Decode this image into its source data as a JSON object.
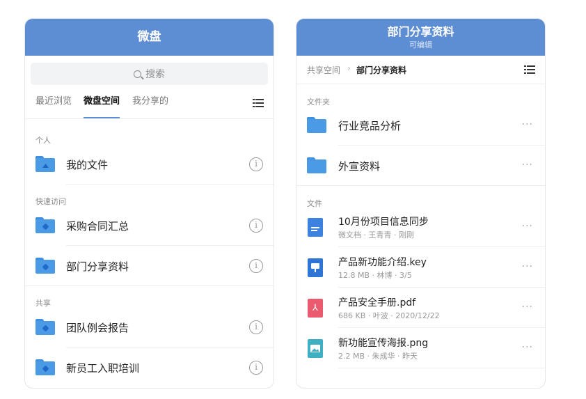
{
  "left_panel": {
    "title": "微盘",
    "search_placeholder": "搜索",
    "tabs": [
      {
        "label": "最近浏览",
        "active": false
      },
      {
        "label": "微盘空间",
        "active": true
      },
      {
        "label": "我分享的",
        "active": false
      }
    ],
    "sections": [
      {
        "label": "个人",
        "items": [
          {
            "name": "我的文件",
            "icon": "person-folder-icon"
          }
        ]
      },
      {
        "label": "快速访问",
        "items": [
          {
            "name": "采购合同汇总",
            "icon": "shared-folder-icon"
          },
          {
            "name": "部门分享资料",
            "icon": "shared-folder-icon"
          }
        ]
      },
      {
        "label": "共享",
        "items": [
          {
            "name": "团队例会报告",
            "icon": "shared-folder-icon"
          },
          {
            "name": "新员工入职培训",
            "icon": "shared-folder-icon"
          }
        ]
      }
    ],
    "info_glyph": "i"
  },
  "right_panel": {
    "title": "部门分享资料",
    "subtitle": "可编辑",
    "breadcrumb": {
      "root": "共享空间",
      "separator": "›",
      "current": "部门分享资料"
    },
    "folders_label": "文件夹",
    "folders": [
      {
        "name": "行业竞品分析"
      },
      {
        "name": "外宣资料"
      }
    ],
    "files_label": "文件",
    "files": [
      {
        "name": "10月份项目信息同步",
        "meta": "微文档 · 王青青 · 刚刚",
        "icon": "doc-icon"
      },
      {
        "name": "产品新功能介绍.key",
        "meta": "12.8 MB · 林博 · 3/5",
        "icon": "keynote-icon"
      },
      {
        "name": "产品安全手册.pdf",
        "meta": "686 KB · 叶波 · 2020/12/22",
        "icon": "pdf-icon"
      },
      {
        "name": "新功能宣传海报.png",
        "meta": "2.2 MB · 朱成华 · 昨天",
        "icon": "image-icon"
      }
    ],
    "more_glyph": "···"
  },
  "colors": {
    "header": "#5d8ed3",
    "folder": "#4b9ae6",
    "accent": "#5d8ed3"
  }
}
